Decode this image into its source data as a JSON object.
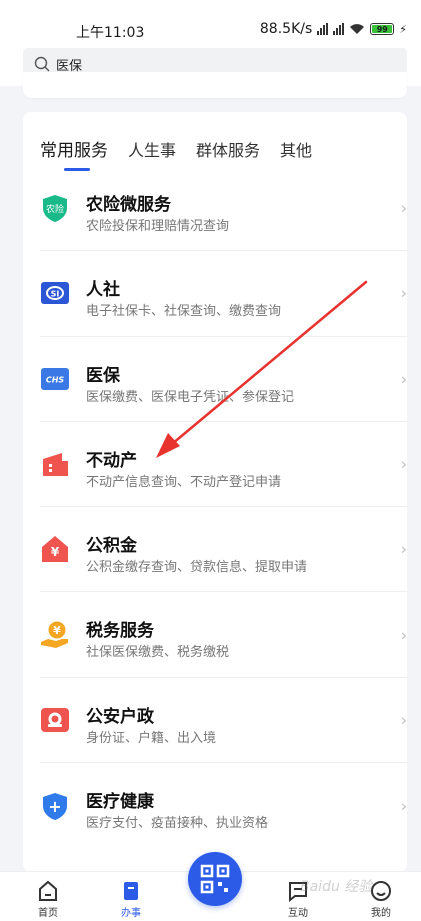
{
  "status_bar": {
    "time": "上午11:03",
    "net_speed": "88.5K/s",
    "battery": "99"
  },
  "search": {
    "query": "医保"
  },
  "tabs": [
    {
      "label": "常用服务",
      "active": true
    },
    {
      "label": "人生事",
      "active": false
    },
    {
      "label": "群体服务",
      "active": false
    },
    {
      "label": "其他",
      "active": false
    }
  ],
  "services": [
    {
      "title": "农险微服务",
      "subtitle": "农险投保和理赔情况查询",
      "icon": "shield-farm-icon",
      "icon_text": "农险",
      "color": "#19b98a"
    },
    {
      "title": "人社",
      "subtitle": "电子社保卡、社保查询、缴费查询",
      "icon": "social-security-icon",
      "icon_text": "SI",
      "color": "#2b56d6"
    },
    {
      "title": "医保",
      "subtitle": "医保缴费、医保电子凭证、参保登记",
      "icon": "chs-card-icon",
      "icon_text": "CHS",
      "color": "#3a78e6"
    },
    {
      "title": "不动产",
      "subtitle": "不动产信息查询、不动产登记申请",
      "icon": "building-icon",
      "icon_text": "",
      "color": "#f0544f"
    },
    {
      "title": "公积金",
      "subtitle": "公积金缴存查询、贷款信息、提取申请",
      "icon": "house-fund-icon",
      "icon_text": "¥",
      "color": "#f0544f"
    },
    {
      "title": "税务服务",
      "subtitle": "社保医保缴费、税务缴税",
      "icon": "tax-coin-icon",
      "icon_text": "¥",
      "color": "#f5a623"
    },
    {
      "title": "公安户政",
      "subtitle": "身份证、户籍、出入境",
      "icon": "police-badge-icon",
      "icon_text": "",
      "color": "#f0544f"
    },
    {
      "title": "医疗健康",
      "subtitle": "医疗支付、疫苗接种、执业资格",
      "icon": "medical-cross-icon",
      "icon_text": "+",
      "color": "#2f7bea"
    }
  ],
  "bottom_nav": [
    {
      "label": "首页",
      "icon": "home-icon",
      "active": false
    },
    {
      "label": "办事",
      "icon": "task-icon",
      "active": true
    },
    {
      "label": "",
      "icon": "qr-scan-icon",
      "active": false
    },
    {
      "label": "互动",
      "icon": "chat-icon",
      "active": false
    },
    {
      "label": "我的",
      "icon": "profile-icon",
      "active": false
    }
  ],
  "watermark": "Baidu 经验",
  "colors": {
    "accent": "#2c5be8",
    "annotation_arrow": "#e8322e"
  }
}
